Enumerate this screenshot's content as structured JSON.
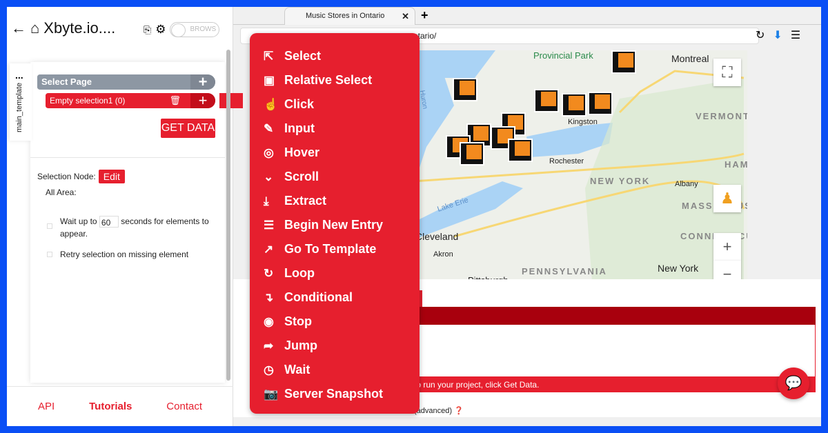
{
  "colors": {
    "brand_red": "#e61f2e",
    "dark_red": "#a8000d",
    "frame_blue": "#0a4ff5",
    "gray_node": "#8d97a3",
    "marker_orange": "#f28a1e"
  },
  "sidebar": {
    "title": "Xbyte.io....",
    "toggle_label": "BROWS",
    "template_tab": "main_template",
    "select_page": "Select Page",
    "selection_item": "Empty selection1  (0)",
    "get_data": "GET DATA",
    "selection_node_label": "Selection Node:",
    "edit_label": "Edit",
    "all_area": "All Area:",
    "wait_prefix": "Wait up to",
    "wait_value": "60",
    "wait_suffix": "seconds for elements to appear.",
    "retry_label": "Retry selection on missing element",
    "footer": {
      "api": "API",
      "tutorials": "Tutorials",
      "contact": "Contact"
    }
  },
  "browser": {
    "tab_title": "Music Stores in Ontario",
    "url": "ntario/",
    "map_labels": {
      "park": "Provincial Park",
      "montreal": "Montreal",
      "kingston": "Kingston",
      "rochester": "Rochester",
      "new_york_state": "NEW YORK",
      "vermont": "VERMONT",
      "albany": "Albany",
      "mass": "MASSACHUS",
      "conn": "CONNECTICU",
      "ham": "HAM",
      "cleveland": "Cleveland",
      "akron": "Akron",
      "lake_erie": "Lake Erie",
      "pennsylvania": "PENNSYLVANIA",
      "new_york_city": "New York",
      "pittsburgh": "Pittsburgh",
      "huron": "Huron"
    },
    "bottom_hint": "to run your project, click Get Data.",
    "advanced": "(advanced)",
    "tab_fragment": ")"
  },
  "menu": {
    "items": [
      {
        "label": "Select",
        "icon": "cursor-click-icon",
        "glyph": "⇱"
      },
      {
        "label": "Relative Select",
        "icon": "relative-select-icon",
        "glyph": "▣"
      },
      {
        "label": "Click",
        "icon": "hand-pointer-icon",
        "glyph": "☝"
      },
      {
        "label": "Input",
        "icon": "pencil-icon",
        "glyph": "✎"
      },
      {
        "label": "Hover",
        "icon": "hover-icon",
        "glyph": "◎"
      },
      {
        "label": "Scroll",
        "icon": "double-chevron-down-icon",
        "glyph": "⌄"
      },
      {
        "label": "Extract",
        "icon": "download-icon",
        "glyph": "⤓"
      },
      {
        "label": "Begin New Entry",
        "icon": "list-icon",
        "glyph": "☰"
      },
      {
        "label": "Go To Template",
        "icon": "go-to-icon",
        "glyph": "↗"
      },
      {
        "label": "Loop",
        "icon": "loop-icon",
        "glyph": "↻"
      },
      {
        "label": "Conditional",
        "icon": "conditional-arrow-icon",
        "glyph": "↴"
      },
      {
        "label": "Stop",
        "icon": "stop-icon",
        "glyph": "◉"
      },
      {
        "label": "Jump",
        "icon": "jump-arrow-icon",
        "glyph": "➦"
      },
      {
        "label": "Wait",
        "icon": "clock-icon",
        "glyph": "◷"
      },
      {
        "label": "Server Snapshot",
        "icon": "camera-icon",
        "glyph": "📷"
      }
    ]
  }
}
